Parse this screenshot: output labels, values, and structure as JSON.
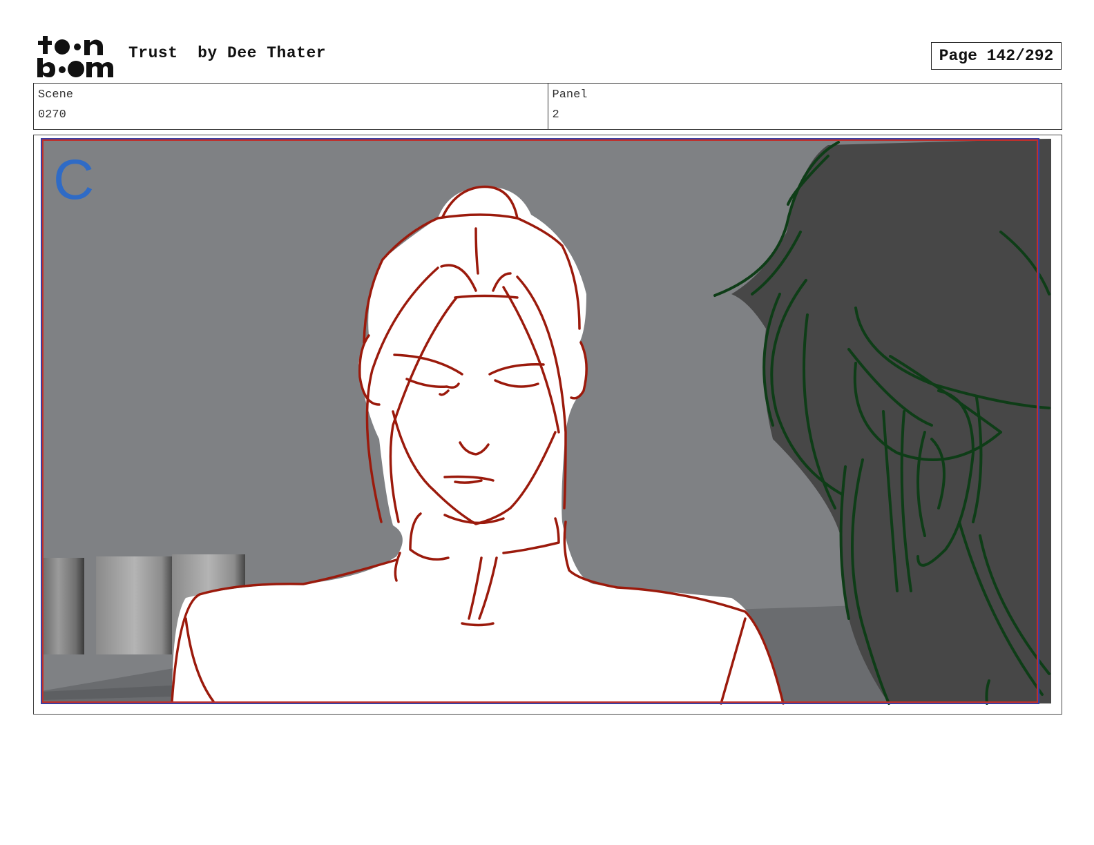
{
  "header": {
    "logo_text": "toon boom",
    "project_title": "Trust",
    "author": "by Dee Thater",
    "page_label": "Page 142/292"
  },
  "info": {
    "scene_label": "Scene",
    "scene_value": "0270",
    "panel_label": "Panel",
    "panel_value": "2"
  },
  "panel": {
    "camera_letter": "C",
    "colors": {
      "background": "#7e8083",
      "foreground_character_outline": "#9b1a0c",
      "background_character_outline": "#0e3d17",
      "background_character_fill": "#474747",
      "camera_frame": "#c0302b",
      "safe_frame": "#3b3fa0",
      "camera_letter": "#2f6bc6"
    }
  }
}
